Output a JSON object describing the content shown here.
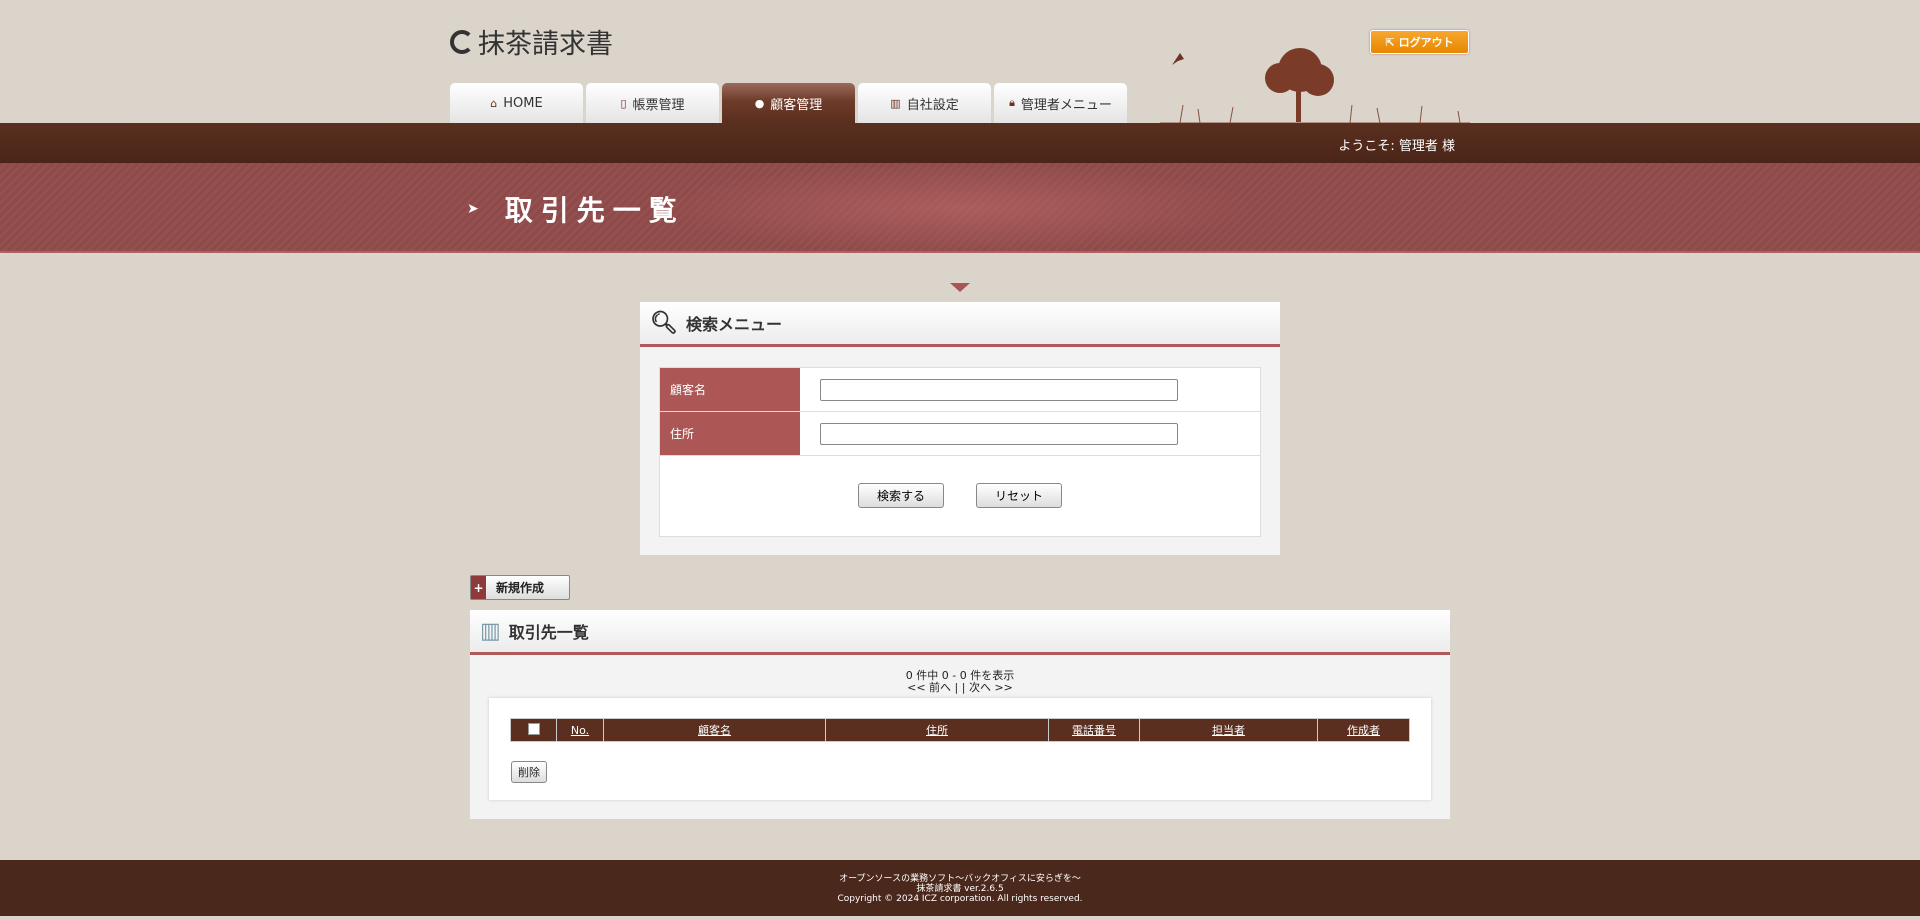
{
  "header": {
    "logo": "抹茶請求書",
    "logout": "ログアウト",
    "welcome": "ようこそ: 管理者 様"
  },
  "tabs": [
    {
      "label": "HOME",
      "icon": "home-icon"
    },
    {
      "label": "帳票管理",
      "icon": "book-icon"
    },
    {
      "label": "顧客管理",
      "icon": "user-icon"
    },
    {
      "label": "自社設定",
      "icon": "building-icon"
    },
    {
      "label": "管理者メニュー",
      "icon": "lock-icon"
    }
  ],
  "page_title": "取引先一覧",
  "search": {
    "title": "検索メニュー",
    "fields": [
      {
        "label": "顧客名",
        "value": ""
      },
      {
        "label": "住所",
        "value": ""
      }
    ],
    "submit": "検索する",
    "reset": "リセット"
  },
  "new_button": "新規作成",
  "list": {
    "title": "取引先一覧",
    "count": "0 件中 0 - 0 件を表示",
    "pager": "<< 前へ | | 次へ >>",
    "columns": [
      "No.",
      "顧客名",
      "住所",
      "電話番号",
      "担当者",
      "作成者"
    ],
    "delete": "削除"
  },
  "footer": {
    "tagline": "オープンソースの業務ソフト～バックオフィスに安らぎを～",
    "version": "抹茶請求書 ver.2.6.5",
    "copyright": "Copyright © 2024 ICZ corporation. All rights reserved."
  }
}
